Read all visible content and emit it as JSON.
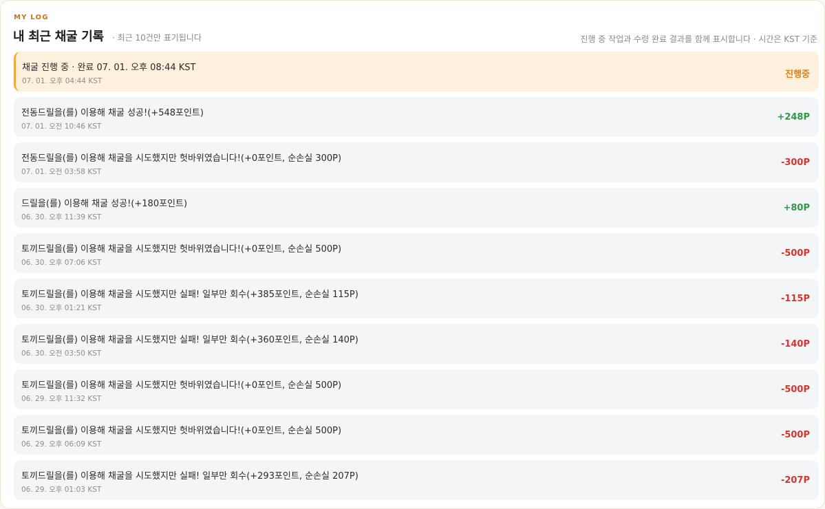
{
  "header": {
    "eyebrow": "MY LOG",
    "title": "내 최근 채굴 기록",
    "subtitle": "· 최근 10건만 표기됩니다",
    "note": "진행 중 작업과 수령 완료 결과를 함께 표시합니다 · 시간은 KST 기준"
  },
  "colors": {
    "accent": "#c9731a",
    "pending_bg": "#fdf0dc",
    "pending_border": "#f2a93b",
    "positive": "#2e9a45",
    "negative": "#d6352f"
  },
  "pending": {
    "message": "채굴 진행 중 · 완료 07. 01. 오후 08:44 KST",
    "time": "07. 01. 오후 04:44 KST",
    "status": "진행중"
  },
  "records": [
    {
      "message": "전동드릴을(를) 이용해 채굴 성공!(+548포인트)",
      "time": "07. 01. 오전 10:46 KST",
      "amount": "+248P",
      "type": "plus"
    },
    {
      "message": "전동드릴을(를) 이용해 채굴을 시도했지만 헛바위였습니다!(+0포인트, 순손실 300P)",
      "time": "07. 01. 오전 03:58 KST",
      "amount": "-300P",
      "type": "minus"
    },
    {
      "message": "드릴을(를) 이용해 채굴 성공!(+180포인트)",
      "time": "06. 30. 오후 11:39 KST",
      "amount": "+80P",
      "type": "plus"
    },
    {
      "message": "토끼드릴을(를) 이용해 채굴을 시도했지만 헛바위였습니다!(+0포인트, 순손실 500P)",
      "time": "06. 30. 오후 07:06 KST",
      "amount": "-500P",
      "type": "minus"
    },
    {
      "message": "토끼드릴을(를) 이용해 채굴을 시도했지만 실패! 일부만 회수(+385포인트, 순손실 115P)",
      "time": "06. 30. 오후 01:21 KST",
      "amount": "-115P",
      "type": "minus"
    },
    {
      "message": "토끼드릴을(를) 이용해 채굴을 시도했지만 실패! 일부만 회수(+360포인트, 순손실 140P)",
      "time": "06. 30. 오전 03:50 KST",
      "amount": "-140P",
      "type": "minus"
    },
    {
      "message": "토끼드릴을(를) 이용해 채굴을 시도했지만 헛바위였습니다!(+0포인트, 순손실 500P)",
      "time": "06. 29. 오후 11:32 KST",
      "amount": "-500P",
      "type": "minus"
    },
    {
      "message": "토끼드릴을(를) 이용해 채굴을 시도했지만 헛바위였습니다!(+0포인트, 순손실 500P)",
      "time": "06. 29. 오후 06:09 KST",
      "amount": "-500P",
      "type": "minus"
    },
    {
      "message": "토끼드릴을(를) 이용해 채굴을 시도했지만 실패! 일부만 회수(+293포인트, 순손실 207P)",
      "time": "06. 29. 오후 01:03 KST",
      "amount": "-207P",
      "type": "minus"
    }
  ]
}
